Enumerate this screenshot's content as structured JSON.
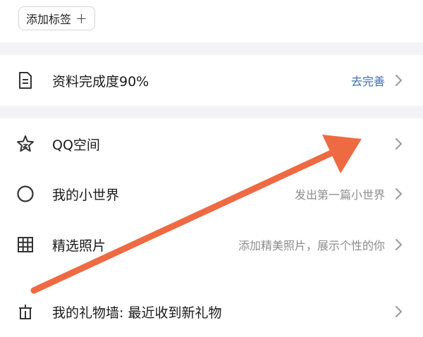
{
  "tag": {
    "add_label": "添加标签",
    "plus": "+"
  },
  "profile": {
    "label": "资料完成度90%",
    "action": "去完善"
  },
  "rows": [
    {
      "label": "QQ空间",
      "hint": ""
    },
    {
      "label": "我的小世界",
      "hint": "发出第一篇小世界"
    },
    {
      "label": "精选照片",
      "hint": "添加精美照片，展示个性的你"
    },
    {
      "label": "我的礼物墙: 最近收到新礼物",
      "hint": ""
    }
  ],
  "icons": {
    "profile": "document-icon",
    "qzone": "star-icon",
    "world": "crescent-circle-icon",
    "photos": "grid-icon",
    "gift": "gift-icon"
  },
  "colors": {
    "accent": "#3b6fb6",
    "annotation_arrow": "#ee6a43",
    "separator": "#f3f3f5"
  }
}
